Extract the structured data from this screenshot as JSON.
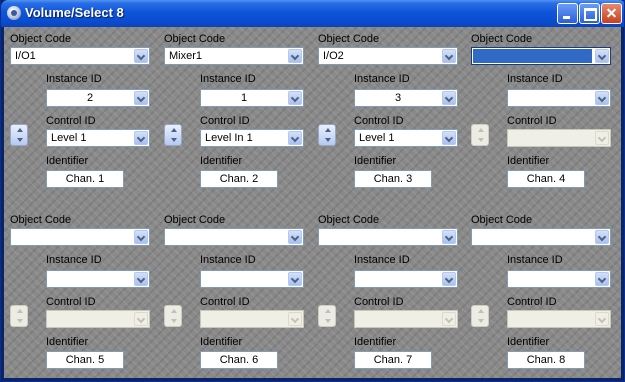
{
  "window": {
    "title": "Volume/Select 8"
  },
  "labels": {
    "object_code": "Object Code",
    "instance_id": "Instance ID",
    "control_id": "Control ID",
    "identifier": "Identifier"
  },
  "channels": [
    {
      "object_code": "I/O1",
      "instance_id": "2",
      "control_id": "Level 1",
      "identifier": "Chan. 1",
      "enabled": true
    },
    {
      "object_code": "Mixer1",
      "instance_id": "1",
      "control_id": "Level In 1",
      "identifier": "Chan. 2",
      "enabled": true
    },
    {
      "object_code": "I/O2",
      "instance_id": "3",
      "control_id": "Level 1",
      "identifier": "Chan. 3",
      "enabled": true
    },
    {
      "object_code": "",
      "instance_id": "",
      "control_id": "",
      "identifier": "Chan. 4",
      "enabled": false,
      "selected": true
    },
    {
      "object_code": "",
      "instance_id": "",
      "control_id": "",
      "identifier": "Chan. 5",
      "enabled": false
    },
    {
      "object_code": "",
      "instance_id": "",
      "control_id": "",
      "identifier": "Chan. 6",
      "enabled": false
    },
    {
      "object_code": "",
      "instance_id": "",
      "control_id": "",
      "identifier": "Chan. 7",
      "enabled": false
    },
    {
      "object_code": "",
      "instance_id": "",
      "control_id": "",
      "identifier": "Chan. 8",
      "enabled": false
    }
  ]
}
